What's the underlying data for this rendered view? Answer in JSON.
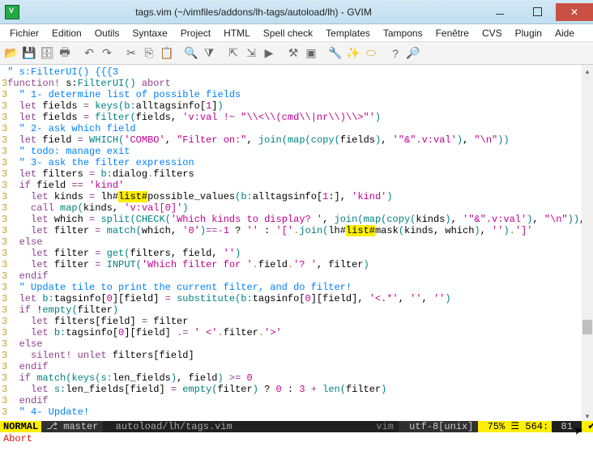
{
  "window": {
    "title": "tags.vim (~/vimfiles/addons/lh-tags/autoload/lh) - GVIM"
  },
  "menubar": {
    "items": [
      "Fichier",
      "Edition",
      "Outils",
      "Syntaxe",
      "Project",
      "HTML",
      "Spell check",
      "Templates",
      "Tampons",
      "Fenêtre",
      "CVS",
      "Plugin",
      "Aide"
    ]
  },
  "statusline": {
    "mode": "NORMAL",
    "branch_icon": "⎇",
    "branch": "master",
    "filepath": "autoload/lh/tags.vim",
    "filetype": "vim",
    "encoding": "utf-8[unix]",
    "percent": "75%",
    "line_icon": "☰",
    "line": "564",
    "col": "81"
  },
  "cmdline": {
    "message": "Abort"
  },
  "code": {
    "lines": [
      {
        "ln": "",
        "html": "<span class='comment'>\" s:FilterUI() {{{3</span>"
      },
      {
        "ln": "3",
        "html": "<span class='keyword'>function!</span> s:<span class='func'>FilterUI</span><span class='paren'>()</span> <span class='keyword'>abort</span>"
      },
      {
        "ln": "3",
        "html": "  <span class='comment'>\" 1- determine list of possible fields</span>"
      },
      {
        "ln": "3",
        "html": "  <span class='keyword'>let</span> fields <span class='keyword'>=</span> <span class='ident'>keys</span><span class='paren'>(</span><span class='ident'>b:</span>alltagsinfo[<span class='num'>1</span>]<span class='paren'>)</span>"
      },
      {
        "ln": "3",
        "html": "  <span class='keyword'>let</span> fields <span class='keyword'>=</span> <span class='ident'>filter</span><span class='paren'>(</span>fields, <span class='string'>'v:val !~ \"\\\\&lt;\\\\(cmd\\\\|nr\\\\)\\\\&gt;\"'</span><span class='paren'>)</span>"
      },
      {
        "ln": "3",
        "html": "  <span class='comment'>\" 2- ask which field</span>"
      },
      {
        "ln": "3",
        "html": "  <span class='keyword'>let</span> field <span class='keyword'>=</span> <span class='ident'>WHICH</span><span class='paren'>(</span><span class='string'>'COMBO'</span>, <span class='string'>\"Filter on:\"</span>, <span class='ident'>join</span><span class='paren'>(</span><span class='ident'>map</span><span class='paren'>(</span><span class='ident'>copy</span><span class='paren'>(</span>fields<span class='paren'>)</span>, <span class='string'>'\"&amp;\".v:val'</span><span class='paren'>)</span>, <span class='string'>\"\\n\"</span><span class='paren'>))</span>"
      },
      {
        "ln": "3",
        "html": "  <span class='comment'>\" todo: manage exit</span>"
      },
      {
        "ln": "3",
        "html": "  <span class='comment'>\" 3- ask the filter expression</span>"
      },
      {
        "ln": "3",
        "html": "  <span class='keyword'>let</span> filters <span class='keyword'>=</span> <span class='ident'>b:</span>dialog<span class='dot'>.</span>filters"
      },
      {
        "ln": "3",
        "html": "  <span class='keyword'>if</span> field <span class='keyword'>==</span> <span class='string'>'kind'</span>"
      },
      {
        "ln": "3",
        "html": "    <span class='keyword'>let</span> kinds <span class='keyword'>=</span> lh#<span class='hl'>list#</span>possible_values<span class='paren'>(</span><span class='ident'>b:</span>alltagsinfo[<span class='num'>1</span>:], <span class='string'>'kind'</span><span class='paren'>)</span>"
      },
      {
        "ln": "3",
        "html": "    <span class='keyword'>call</span> <span class='ident'>map</span><span class='paren'>(</span>kinds, <span class='string'>'v:val[0]'</span><span class='paren'>)</span>"
      },
      {
        "ln": "3",
        "html": "    <span class='keyword'>let</span> which <span class='keyword'>=</span> <span class='ident'>split</span><span class='paren'>(</span><span class='ident'>CHECK</span><span class='paren'>(</span><span class='string'>'Which kinds to display? '</span>, <span class='ident'>join</span><span class='paren'>(</span><span class='ident'>map</span><span class='paren'>(</span><span class='ident'>copy</span><span class='paren'>(</span>kinds<span class='paren'>)</span>, <span class='string'>'\"&amp;\".v:val'</span><span class='paren'>)</span>, <span class='string'>\"\\n\"</span><span class='paren'>))</span>, <span class='string'>'\\zs\\ze'</span><span class='paren'>)</span>"
      },
      {
        "ln": "3",
        "html": "    <span class='keyword'>let</span> filter <span class='keyword'>=</span> <span class='ident'>match</span><span class='paren'>(</span>which, <span class='string'>'0'</span><span class='paren'>)</span><span class='keyword'>==-</span><span class='num'>1</span> ? <span class='string'>''</span> : <span class='string'>'['</span><span class='dot'>.</span><span class='ident'>join</span><span class='paren'>(</span>lh#<span class='hl'>list#</span>mask<span class='paren'>(</span>kinds, which<span class='paren'>)</span>, <span class='string'>''</span><span class='paren'>)</span><span class='dot'>.</span><span class='string'>']'</span>"
      },
      {
        "ln": "3",
        "html": "  <span class='keyword'>else</span>"
      },
      {
        "ln": "3",
        "html": "    <span class='keyword'>let</span> filter <span class='keyword'>=</span> <span class='ident'>get</span><span class='paren'>(</span>filters, field, <span class='string'>''</span><span class='paren'>)</span>"
      },
      {
        "ln": "3",
        "html": "    <span class='keyword'>let</span> filter <span class='keyword'>=</span> <span class='ident'>INPUT</span><span class='paren'>(</span><span class='string'>'Which filter for '</span><span class='dot'>.</span>field<span class='dot'>.</span><span class='string'>'? '</span>, filter<span class='paren'>)</span>"
      },
      {
        "ln": "3",
        "html": "  <span class='keyword'>endif</span>"
      },
      {
        "ln": "3",
        "html": "  <span class='comment'>\" Update tile to print the current filter, and do filter!</span>"
      },
      {
        "ln": "3",
        "html": "  <span class='keyword'>let</span> <span class='ident'>b:</span>tagsinfo[<span class='num'>0</span>][field] <span class='keyword'>=</span> <span class='ident'>substitute</span><span class='paren'>(</span><span class='ident'>b:</span>tagsinfo[<span class='num'>0</span>][field], <span class='string'>'&lt;.*'</span>, <span class='string'>''</span>, <span class='string'>''</span><span class='paren'>)</span>"
      },
      {
        "ln": "3",
        "html": "  <span class='keyword'>if</span> !<span class='ident'>empty</span><span class='paren'>(</span>filter<span class='paren'>)</span>"
      },
      {
        "ln": "3",
        "html": "    <span class='keyword'>let</span> filters[field] <span class='keyword'>=</span> filter"
      },
      {
        "ln": "3",
        "html": "    <span class='keyword'>let</span> <span class='ident'>b:</span>tagsinfo[<span class='num'>0</span>][field] <span class='keyword'>.=</span> <span class='string'>' &lt;'</span><span class='dot'>.</span>filter<span class='dot'>.</span><span class='string'>'&gt;'</span>"
      },
      {
        "ln": "3",
        "html": "  <span class='keyword'>else</span>"
      },
      {
        "ln": "3",
        "html": "    <span class='keyword'>silent!</span> <span class='keyword'>unlet</span> filters[field]"
      },
      {
        "ln": "3",
        "html": "  <span class='keyword'>endif</span>"
      },
      {
        "ln": "3",
        "html": "  <span class='keyword'>if</span> <span class='ident'>match</span><span class='paren'>(</span><span class='ident'>keys</span><span class='paren'>(</span><span class='ident'>s:</span>len_fields<span class='paren'>)</span>, field<span class='paren'>)</span> <span class='keyword'>&gt;=</span> <span class='num'>0</span>"
      },
      {
        "ln": "3",
        "html": "    <span class='keyword'>let</span> <span class='ident'>s:</span>len_fields[field] <span class='keyword'>=</span> <span class='ident'>empty</span><span class='paren'>(</span>filter<span class='paren'>)</span> ? <span class='num'>0</span> : <span class='num'>3</span> <span class='keyword'>+</span> <span class='ident'>len</span><span class='paren'>(</span>filter<span class='paren'>)</span>"
      },
      {
        "ln": "3",
        "html": "  <span class='keyword'>endif</span>"
      },
      {
        "ln": "3",
        "html": "  <span class='comment'>\" 4- Update!</span>"
      }
    ]
  }
}
